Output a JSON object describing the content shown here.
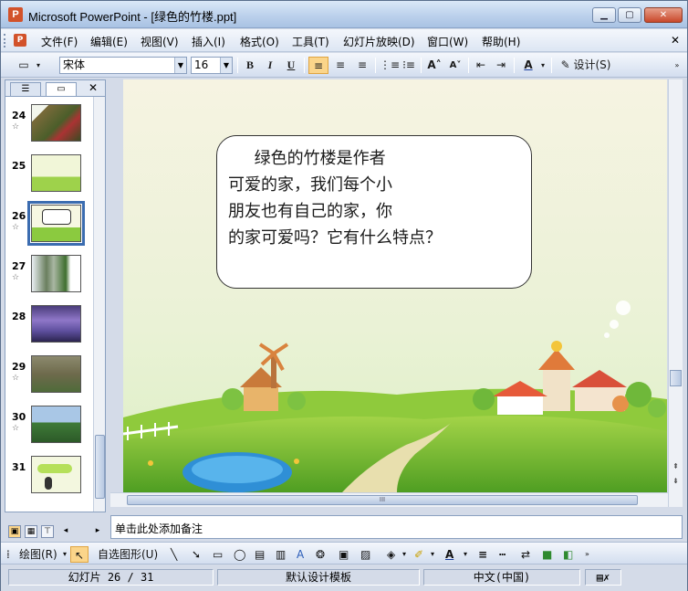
{
  "window": {
    "title": "Microsoft PowerPoint - [绿色的竹楼.ppt]",
    "min_label": "▁",
    "max_label": "▢",
    "close_label": "✕",
    "app_icon_label": "P"
  },
  "menu": {
    "items": [
      "文件(F)",
      "编辑(E)",
      "视图(V)",
      "插入(I)",
      "格式(O)",
      "工具(T)",
      "幻灯片放映(D)",
      "窗口(W)",
      "帮助(H)"
    ],
    "close_label": "✕"
  },
  "toolbar": {
    "font": "宋体",
    "size": "16",
    "bold": "B",
    "italic": "I",
    "underline": "U",
    "design_label": "设计(S)"
  },
  "left_pane": {
    "tab_outline": "☰",
    "tab_slides": "▭",
    "close": "✕",
    "star": "☆",
    "slides": [
      {
        "num": "24",
        "has_star": true
      },
      {
        "num": "25",
        "has_star": false
      },
      {
        "num": "26",
        "has_star": true,
        "selected": true
      },
      {
        "num": "27",
        "has_star": true
      },
      {
        "num": "28",
        "has_star": false
      },
      {
        "num": "29",
        "has_star": true
      },
      {
        "num": "30",
        "has_star": true
      },
      {
        "num": "31",
        "has_star": false
      }
    ]
  },
  "slide": {
    "bubble_text": "     绿色的竹楼是作者\n可爱的家，我们每个小\n朋友也有自己的家，你\n的家可爱吗？它有什么特点？"
  },
  "notes": {
    "placeholder": "单击此处添加备注"
  },
  "drawbar": {
    "draw_label": "绘图(R)",
    "autoshape_label": "自选图形(U)"
  },
  "status": {
    "slide_info": "幻灯片 26 / 31",
    "template": "默认设计模板",
    "language": "中文(中国)"
  },
  "colors": {
    "accent": "#3b6cb0",
    "selected_tool": "#fbd58a",
    "sky_top": "#f7f6e4",
    "grass": "#7cc23a"
  }
}
